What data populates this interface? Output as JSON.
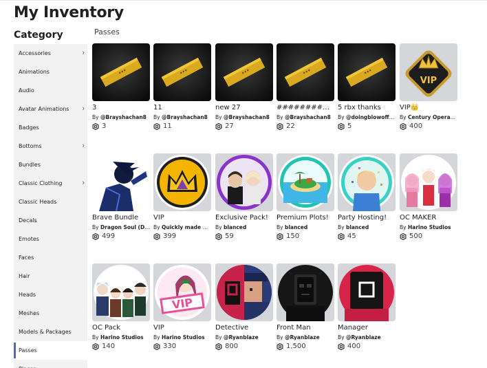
{
  "page": {
    "title": "My Inventory",
    "category_heading": "Category",
    "section": "Passes"
  },
  "colors": {
    "sidebar_bg": "#f2f2f2",
    "active_indicator": "#5a6b9a",
    "thumb_bg": "#d4d6d9"
  },
  "sidebar": {
    "items": [
      {
        "label": "Accessories",
        "has_submenu": true
      },
      {
        "label": "Animations",
        "has_submenu": false
      },
      {
        "label": "Audio",
        "has_submenu": false
      },
      {
        "label": "Avatar Animations",
        "has_submenu": true
      },
      {
        "label": "Badges",
        "has_submenu": false
      },
      {
        "label": "Bottoms",
        "has_submenu": true
      },
      {
        "label": "Bundles",
        "has_submenu": false
      },
      {
        "label": "Classic Clothing",
        "has_submenu": true
      },
      {
        "label": "Classic Heads",
        "has_submenu": false
      },
      {
        "label": "Decals",
        "has_submenu": false
      },
      {
        "label": "Emotes",
        "has_submenu": false
      },
      {
        "label": "Faces",
        "has_submenu": false
      },
      {
        "label": "Hair",
        "has_submenu": false
      },
      {
        "label": "Heads",
        "has_submenu": false
      },
      {
        "label": "Meshes",
        "has_submenu": false
      },
      {
        "label": "Models & Packages",
        "has_submenu": false
      },
      {
        "label": "Passes",
        "has_submenu": false,
        "active": true
      },
      {
        "label": "Places",
        "has_submenu": false
      }
    ]
  },
  "by_prefix": "By",
  "items": [
    {
      "name": "3",
      "creator": "@Brayshachan8",
      "price": "3",
      "thumb": "ticket-icon"
    },
    {
      "name": "11",
      "creator": "@Brayshachan8",
      "price": "11",
      "thumb": "ticket-icon"
    },
    {
      "name": "new 27",
      "creator": "@Brayshachan8",
      "price": "27",
      "thumb": "ticket-icon"
    },
    {
      "name": "##########...",
      "creator": "@Brayshachan8",
      "price": "22",
      "thumb": "ticket-icon"
    },
    {
      "name": "5 rbx thanks",
      "creator": "@doingblowoffat...",
      "price": "5",
      "thumb": "ticket-icon"
    },
    {
      "name": "VIP👑",
      "creator": "Century Operators",
      "price": "400",
      "thumb": "vip-crown-badge-icon"
    },
    {
      "name": "Brave Bundle",
      "creator": "Dragon Soul (DS)",
      "price": "499",
      "thumb": "anime-character-art"
    },
    {
      "name": "VIP",
      "creator": "Quickly made ga...",
      "price": "399",
      "thumb": "crown-circle-icon"
    },
    {
      "name": "Exclusive Pack!",
      "creator": "blanced",
      "price": "59",
      "thumb": "avatar-duo-art"
    },
    {
      "name": "Premium Plots!",
      "creator": "blanced",
      "price": "150",
      "thumb": "island-art"
    },
    {
      "name": "Party Hosting!",
      "creator": "blanced",
      "price": "45",
      "thumb": "party-avatar-art"
    },
    {
      "name": "OC MAKER",
      "creator": "Harino Studios",
      "price": "500",
      "thumb": "oc-maker-art"
    },
    {
      "name": "OC Pack",
      "creator": "Harino Studios",
      "price": "140",
      "thumb": "oc-pack-art"
    },
    {
      "name": "VIP",
      "creator": "Harino Studios",
      "price": "330",
      "thumb": "vip-character-art"
    },
    {
      "name": "Detective",
      "creator": "@Ryanblaze",
      "price": "800",
      "thumb": "detective-art"
    },
    {
      "name": "Front Man",
      "creator": "@Ryanblaze",
      "price": "1,500",
      "thumb": "front-man-mask-art"
    },
    {
      "name": "Manager",
      "creator": "@Ryanblaze",
      "price": "400",
      "thumb": "square-mask-art"
    }
  ]
}
